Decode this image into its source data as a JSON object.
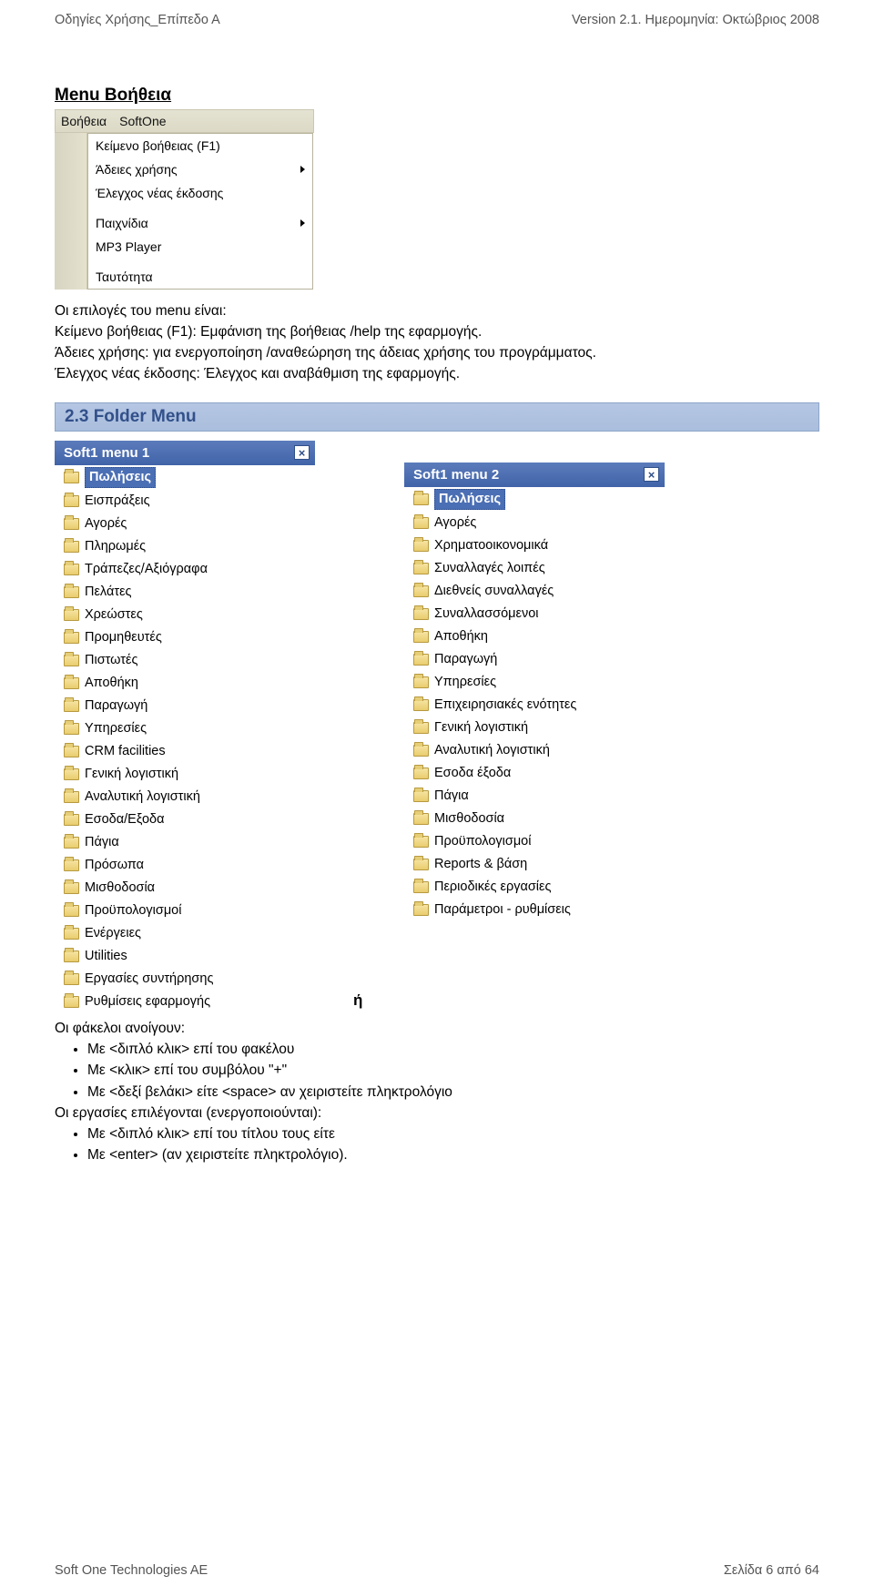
{
  "header": {
    "left": "Οδηγίες Χρήσης_Επίπεδο Α",
    "right": "Version 2.1. Ημερομηνία: Οκτώβριος 2008"
  },
  "help_section": {
    "title": "Menu Βοήθεια",
    "menubar": {
      "item1": "Βοήθεια",
      "item2": "SoftOne"
    },
    "items": {
      "i1": "Κείμενο βοήθειας (F1)",
      "i2": "Άδειες χρήσης",
      "i3": "Έλεγχος νέας έκδοσης",
      "i4": "Παιχνίδια",
      "i5": "MP3 Player",
      "i6": "Ταυτότητα"
    },
    "paragraphs": {
      "p0": "Οι επιλογές του menu είναι:",
      "p1": "Κείμενο βοήθειας (F1): Εμφάνιση της βοήθειας /help της εφαρμογής.",
      "p2": "Άδειες χρήσης: για ενεργοποίηση /αναθεώρηση της άδειας χρήσης του προγράμματος.",
      "p3": "Έλεγχος νέας έκδοσης: Έλεγχος και αναβάθμιση της εφαρμογής."
    }
  },
  "folder_section": {
    "heading": "2.3 Folder  Menu",
    "panel1_title": "Soft1 menu 1",
    "panel2_title": "Soft1 menu 2",
    "or_label": "ή",
    "menu1": [
      "Πωλήσεις",
      "Εισπράξεις",
      "Αγορές",
      "Πληρωμές",
      "Τράπεζες/Αξιόγραφα",
      "Πελάτες",
      "Χρεώστες",
      "Προμηθευτές",
      "Πιστωτές",
      "Αποθήκη",
      "Παραγωγή",
      "Υπηρεσίες",
      "CRM facilities",
      "Γενική λογιστική",
      "Αναλυτική λογιστική",
      "Εσοδα/Εξοδα",
      "Πάγια",
      "Πρόσωπα",
      "Μισθοδοσία",
      "Προϋπολογισμοί",
      "Ενέργειες",
      "Utilities",
      "Εργασίες συντήρησης",
      "Ρυθμίσεις εφαρμογής"
    ],
    "menu2": [
      "Πωλήσεις",
      "Αγορές",
      "Χρηματοοικονομικά",
      "Συναλλαγές λοιπές",
      "Διεθνείς συναλλαγές",
      "Συναλλασσόμενοι",
      "Αποθήκη",
      "Παραγωγή",
      "Υπηρεσίες",
      "Επιχειρησιακές ενότητες",
      "Γενική λογιστική",
      "Αναλυτική λογιστική",
      "Εσοδα έξοδα",
      "Πάγια",
      "Μισθοδοσία",
      "Προϋπολογισμοί",
      "Reports & βάση",
      "Περιοδικές εργασίες",
      "Παράμετροι - ρυθμίσεις"
    ],
    "open_intro": "Οι φάκελοι ανοίγουν:",
    "open_bullets": [
      "Με <διπλό κλικ> επί του φακέλου",
      "Με <κλικ> επί του συμβόλου \"+\"",
      "Με <δεξί βελάκι> είτε <space> αν χειριστείτε πληκτρολόγιο"
    ],
    "select_intro": "Οι εργασίες επιλέγονται (ενεργοποιούνται):",
    "select_bullets": [
      "Με <διπλό κλικ> επί του τίτλου τους είτε",
      "Με <enter> (αν χειριστείτε πληκτρολόγιο)."
    ]
  },
  "footer": {
    "left": "Soft One Technologies AE",
    "right": "Σελίδα 6 από 64"
  }
}
